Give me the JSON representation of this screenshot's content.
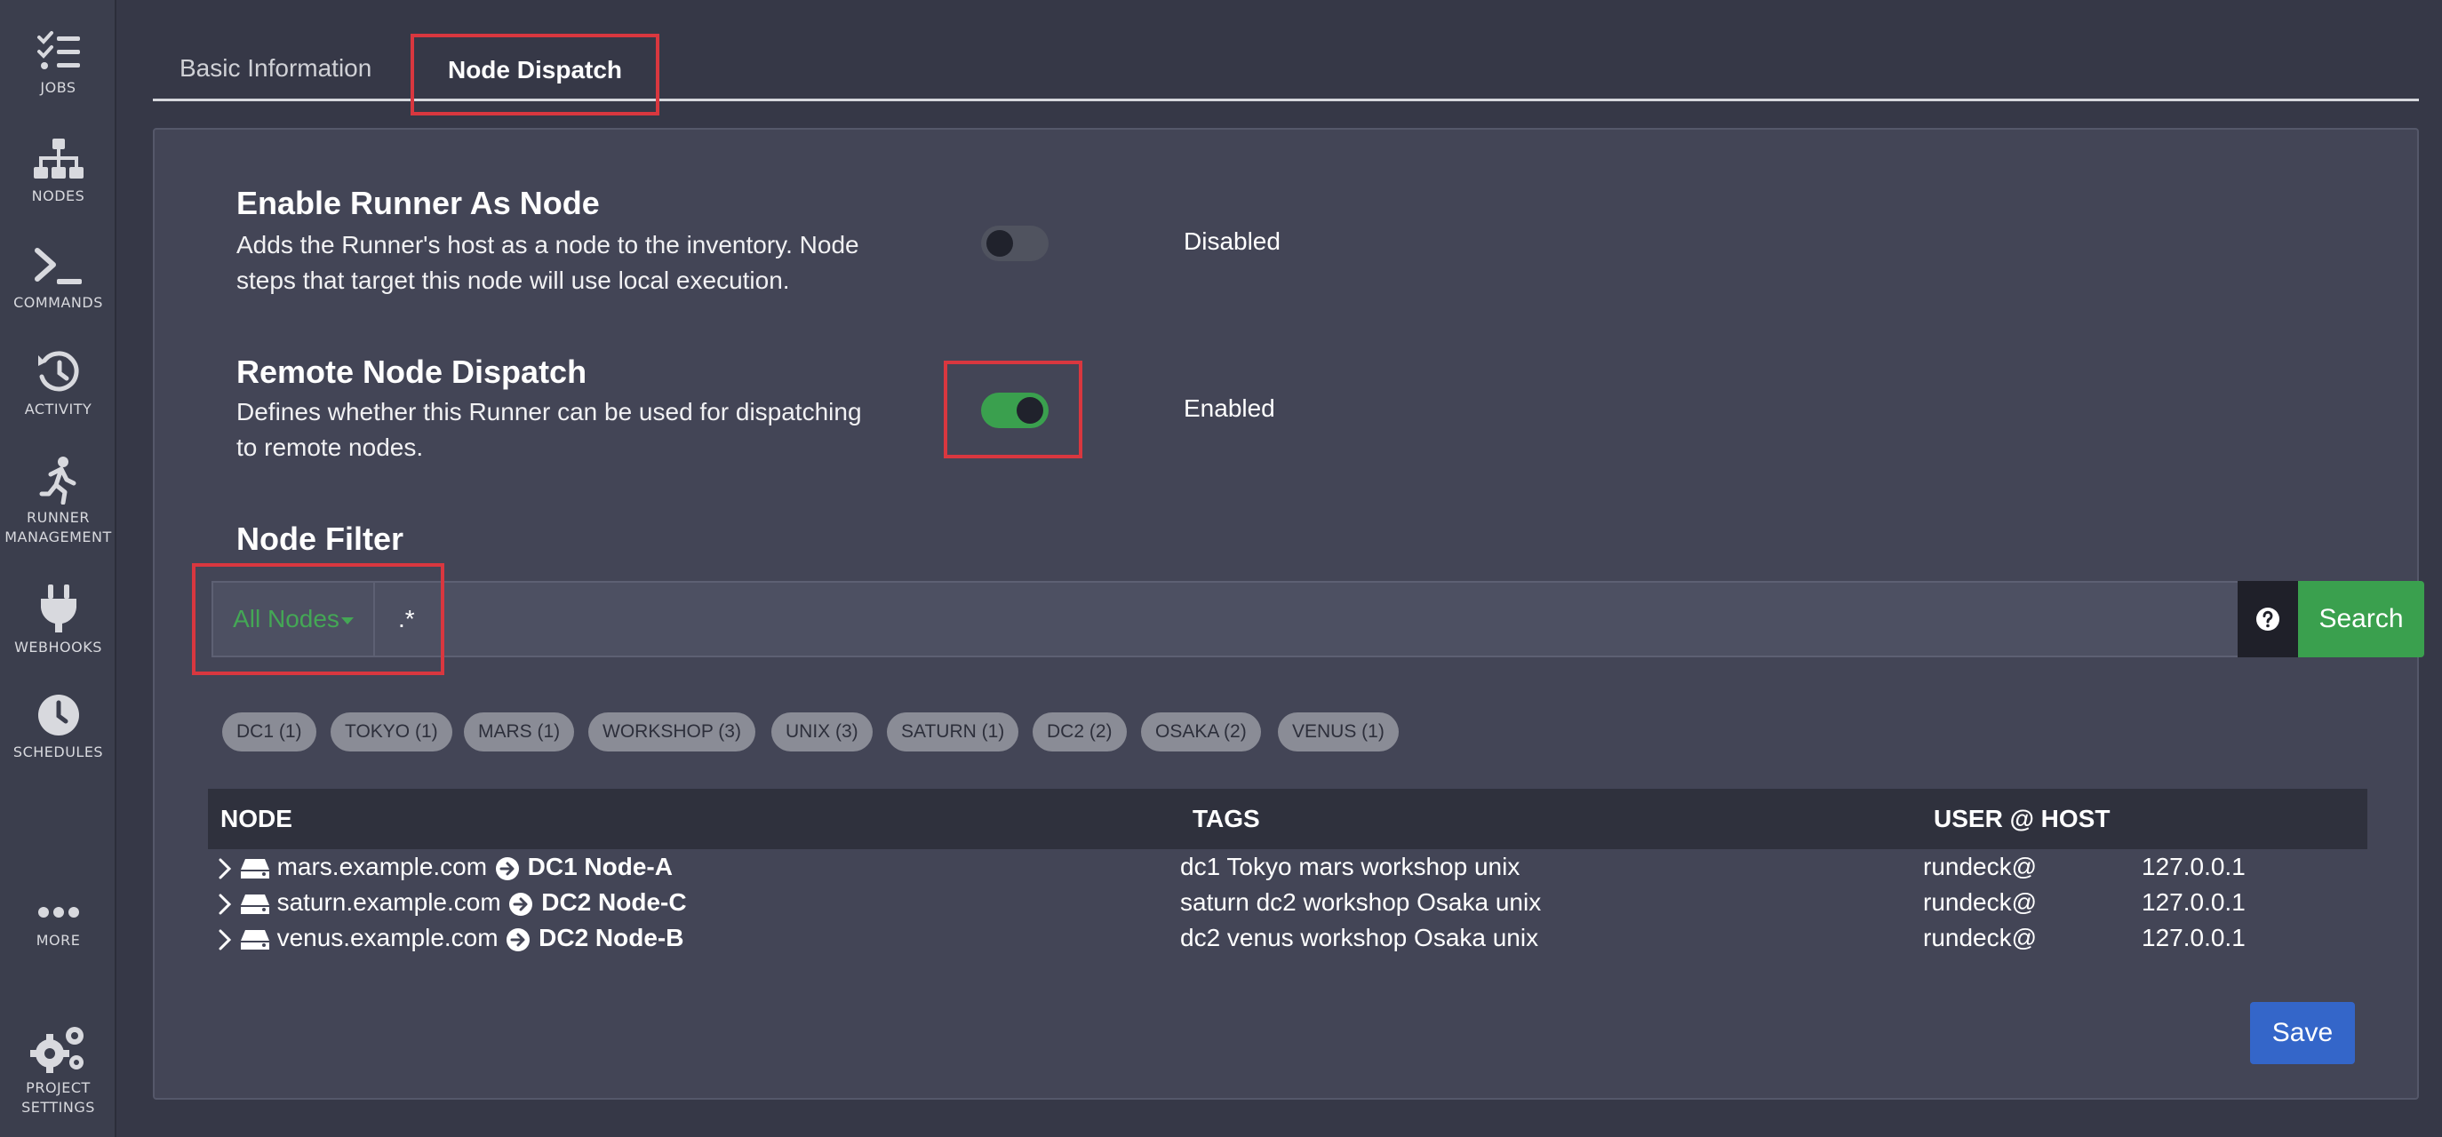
{
  "sidebar": {
    "items": [
      {
        "label": "JOBS",
        "icon": "jobs-checklist-icon"
      },
      {
        "label": "NODES",
        "icon": "nodes-sitemap-icon"
      },
      {
        "label": "COMMANDS",
        "icon": "terminal-prompt-icon"
      },
      {
        "label": "ACTIVITY",
        "icon": "history-icon"
      },
      {
        "label": "RUNNER",
        "label2": "MANAGEMENT",
        "icon": "runner-icon"
      },
      {
        "label": "WEBHOOKS",
        "icon": "plug-icon"
      },
      {
        "label": "SCHEDULES",
        "icon": "clock-icon"
      },
      {
        "label": "MORE",
        "icon": "ellipsis-icon"
      },
      {
        "label": "PROJECT",
        "label2": "SETTINGS",
        "icon": "gears-icon"
      }
    ]
  },
  "tabs": [
    {
      "label": "Basic Information",
      "active": false
    },
    {
      "label": "Node Dispatch",
      "active": true
    }
  ],
  "enable_runner": {
    "title": "Enable Runner As Node",
    "desc_line1": "Adds the Runner's host as a node to the inventory. Node",
    "desc_line2": "steps that target this node will use local execution.",
    "state": "Disabled",
    "enabled": false
  },
  "remote_dispatch": {
    "title": "Remote Node Dispatch",
    "desc_line1": "Defines whether this Runner can be used for dispatching",
    "desc_line2": "to remote nodes.",
    "state": "Enabled",
    "enabled": true
  },
  "node_filter": {
    "title": "Node Filter",
    "dropdown_label": "All Nodes",
    "value": ".*",
    "search_label": "Search"
  },
  "tag_pills": [
    "DC1 (1)",
    "TOKYO (1)",
    "MARS (1)",
    "WORKSHOP (3)",
    "UNIX (3)",
    "SATURN (1)",
    "DC2 (2)",
    "OSAKA (2)",
    "VENUS (1)"
  ],
  "table": {
    "headers": {
      "node": "NODE",
      "tags": "TAGS",
      "user_host": "USER @ HOST"
    },
    "rows": [
      {
        "host": "mars.example.com",
        "label": "DC1 Node-A",
        "tags": "dc1 Tokyo mars workshop unix",
        "user": "rundeck@",
        "ip": "127.0.0.1"
      },
      {
        "host": "saturn.example.com",
        "label": "DC2 Node-C",
        "tags": "saturn dc2 workshop Osaka unix",
        "user": "rundeck@",
        "ip": "127.0.0.1"
      },
      {
        "host": "venus.example.com",
        "label": "DC2 Node-B",
        "tags": "dc2 venus workshop Osaka unix",
        "user": "rundeck@",
        "ip": "127.0.0.1"
      }
    ]
  },
  "save_label": "Save",
  "colors": {
    "accent_green": "#3aa04e",
    "highlight_red": "#d9373f",
    "save_blue": "#3466c9"
  }
}
